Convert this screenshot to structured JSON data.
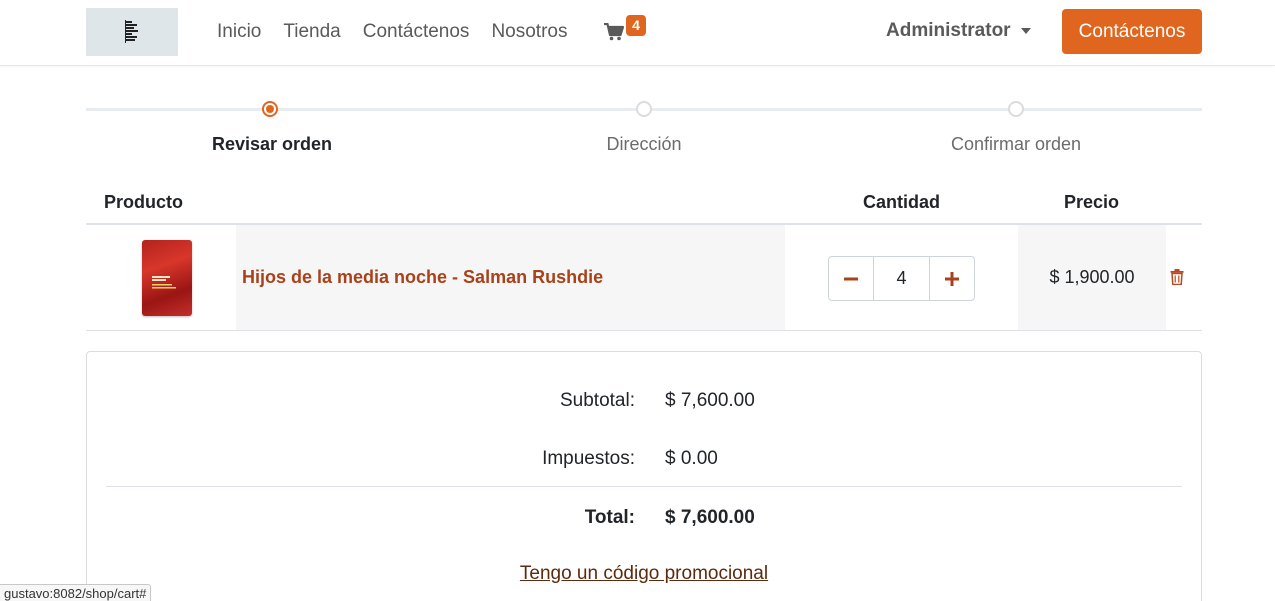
{
  "header": {
    "logo_icon": "bookstore-logo",
    "nav": [
      "Inicio",
      "Tienda",
      "Contáctenos",
      "Nosotros"
    ],
    "cart_icon": "shopping-cart-icon",
    "cart_count": "4",
    "user": "Administrator",
    "cta": "Contáctenos"
  },
  "wizard": {
    "steps": [
      "Revisar orden",
      "Dirección",
      "Confirmar orden"
    ],
    "active_index": 0
  },
  "table": {
    "headers": {
      "product": "Producto",
      "quantity": "Cantidad",
      "price": "Precio"
    },
    "rows": [
      {
        "name": "Hijos de la media noche - Salman Rushdie",
        "quantity": "4",
        "price": "$ 1,900.00",
        "cover_icon": "book-cover-image"
      }
    ]
  },
  "summary": {
    "subtotal_label": "Subtotal:",
    "subtotal": "$ 7,600.00",
    "taxes_label": "Impuestos:",
    "taxes": "$ 0.00",
    "total_label": "Total:",
    "total": "$ 7,600.00",
    "promo": "Tengo un código promocional"
  },
  "statusbar": "gustavo:8082/shop/cart#",
  "colors": {
    "accent": "#e0661f",
    "product_link": "#a8421a",
    "promo_link": "#5b2a0f"
  }
}
